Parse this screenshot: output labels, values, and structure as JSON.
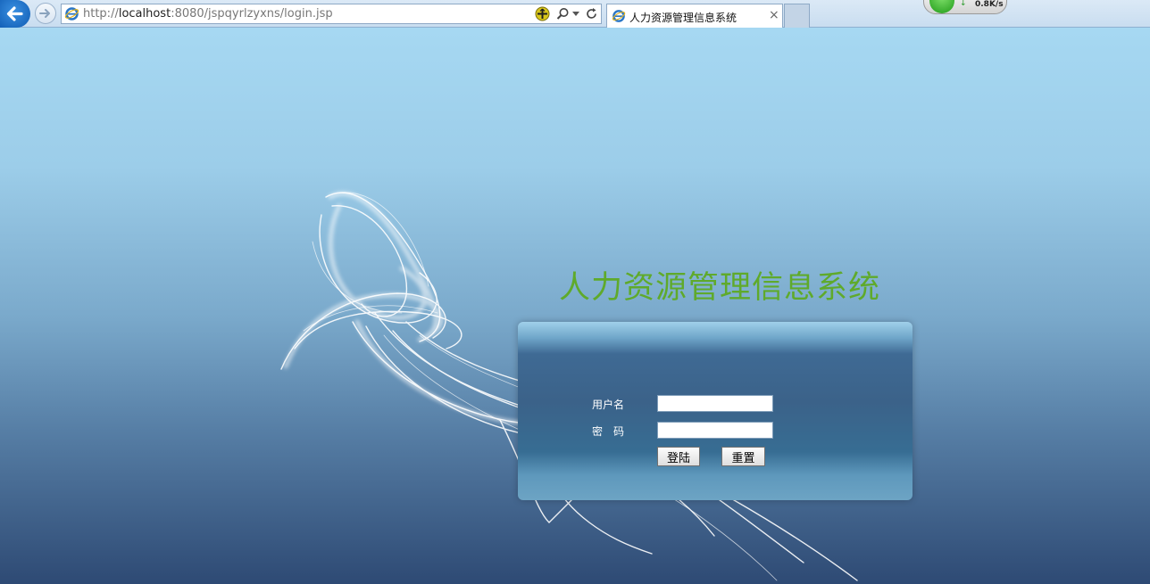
{
  "browser": {
    "address_url_prefix": "http://",
    "address_url_host": "localhost",
    "address_url_path": ":8080/jspqyrlzyxns/login.jsp",
    "tab_title": "人力资源管理信息系统",
    "tab_close": "×",
    "speed_text": "0.8K/s",
    "speed_arrow": "↓"
  },
  "page": {
    "system_title": "人力资源管理信息系统",
    "username_label": "用户名",
    "password_label": "密码",
    "username_value": "",
    "password_value": "",
    "login_button": "登陆",
    "reset_button": "重置"
  },
  "colors": {
    "title_green": "#5faa2b",
    "panel_dark": "#3b6289",
    "sky_top": "#a6d8f2",
    "sky_bottom": "#2e4a74"
  }
}
